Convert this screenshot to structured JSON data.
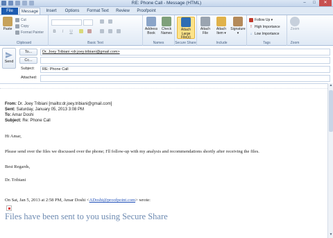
{
  "window": {
    "title": "RE: Phone Call - Message (HTML)",
    "controls": {
      "minimize": "–",
      "maximize": "□",
      "close": "✕"
    }
  },
  "tabs": [
    "File",
    "Message",
    "Insert",
    "Options",
    "Format Text",
    "Review",
    "Proofpoint"
  ],
  "ribbon": {
    "clipboard": {
      "paste": "Paste",
      "cut": "Cut",
      "copy": "Copy",
      "format_painter": "Format Painter",
      "label": "Clipboard"
    },
    "basic_text": {
      "bold": "B",
      "italic": "I",
      "underline": "U",
      "label": "Basic Text"
    },
    "names": {
      "address_book": "Address Book",
      "check_names": "Check Names",
      "label": "Names"
    },
    "secure_share": {
      "attach_large": "Attach Large File(s)",
      "label": "Secure Share"
    },
    "include": {
      "attach_file": "Attach File",
      "attach_item": "Attach Item ▾",
      "signature": "Signature ▾",
      "label": "Include"
    },
    "tags": {
      "follow_up": "Follow Up ▾",
      "high": "High Importance",
      "low": "Low Importance",
      "label": "Tags"
    },
    "zoom": {
      "zoom": "Zoom",
      "label": "Zoom"
    }
  },
  "compose": {
    "send": "Send",
    "to_label": "To...",
    "to_value": "Dr. Joey Tribiani <dr.joey.tribiani@gmail.com>",
    "cc_label": "Cc...",
    "cc_value": "",
    "subject_label": "Subject:",
    "subject_value": "RE: Phone Call",
    "attached_label": "Attached:",
    "attached_value": ""
  },
  "message": {
    "from_label": "From:",
    "from_value": "Dr. Joey Tribiani [mailto:dr.joey.tribiani@gmail.com]",
    "sent_label": "Sent:",
    "sent_value": "Saturday, January 05, 2013 3:08 PM",
    "to_label": "To:",
    "to_value": "Amar Doshi",
    "subject_label": "Subject:",
    "subject_value": "Re: Phone Call",
    "greeting": "Hi Amar,",
    "body": "Please send over the files we discussed over the phone; I'll follow-up with my analysis and recommendations shortly after receiving the files.",
    "closing": "Best Regards,",
    "signature": "Dr. Tribiani",
    "quote_prefix": "On Sat, Jan 5, 2013 at 2:58 PM, Amar Doshi <",
    "quote_email": "ADoshi@proofpoint.com",
    "quote_suffix": "> wrote:",
    "quoted_heading": "Files have been sent to you using Secure Share"
  }
}
